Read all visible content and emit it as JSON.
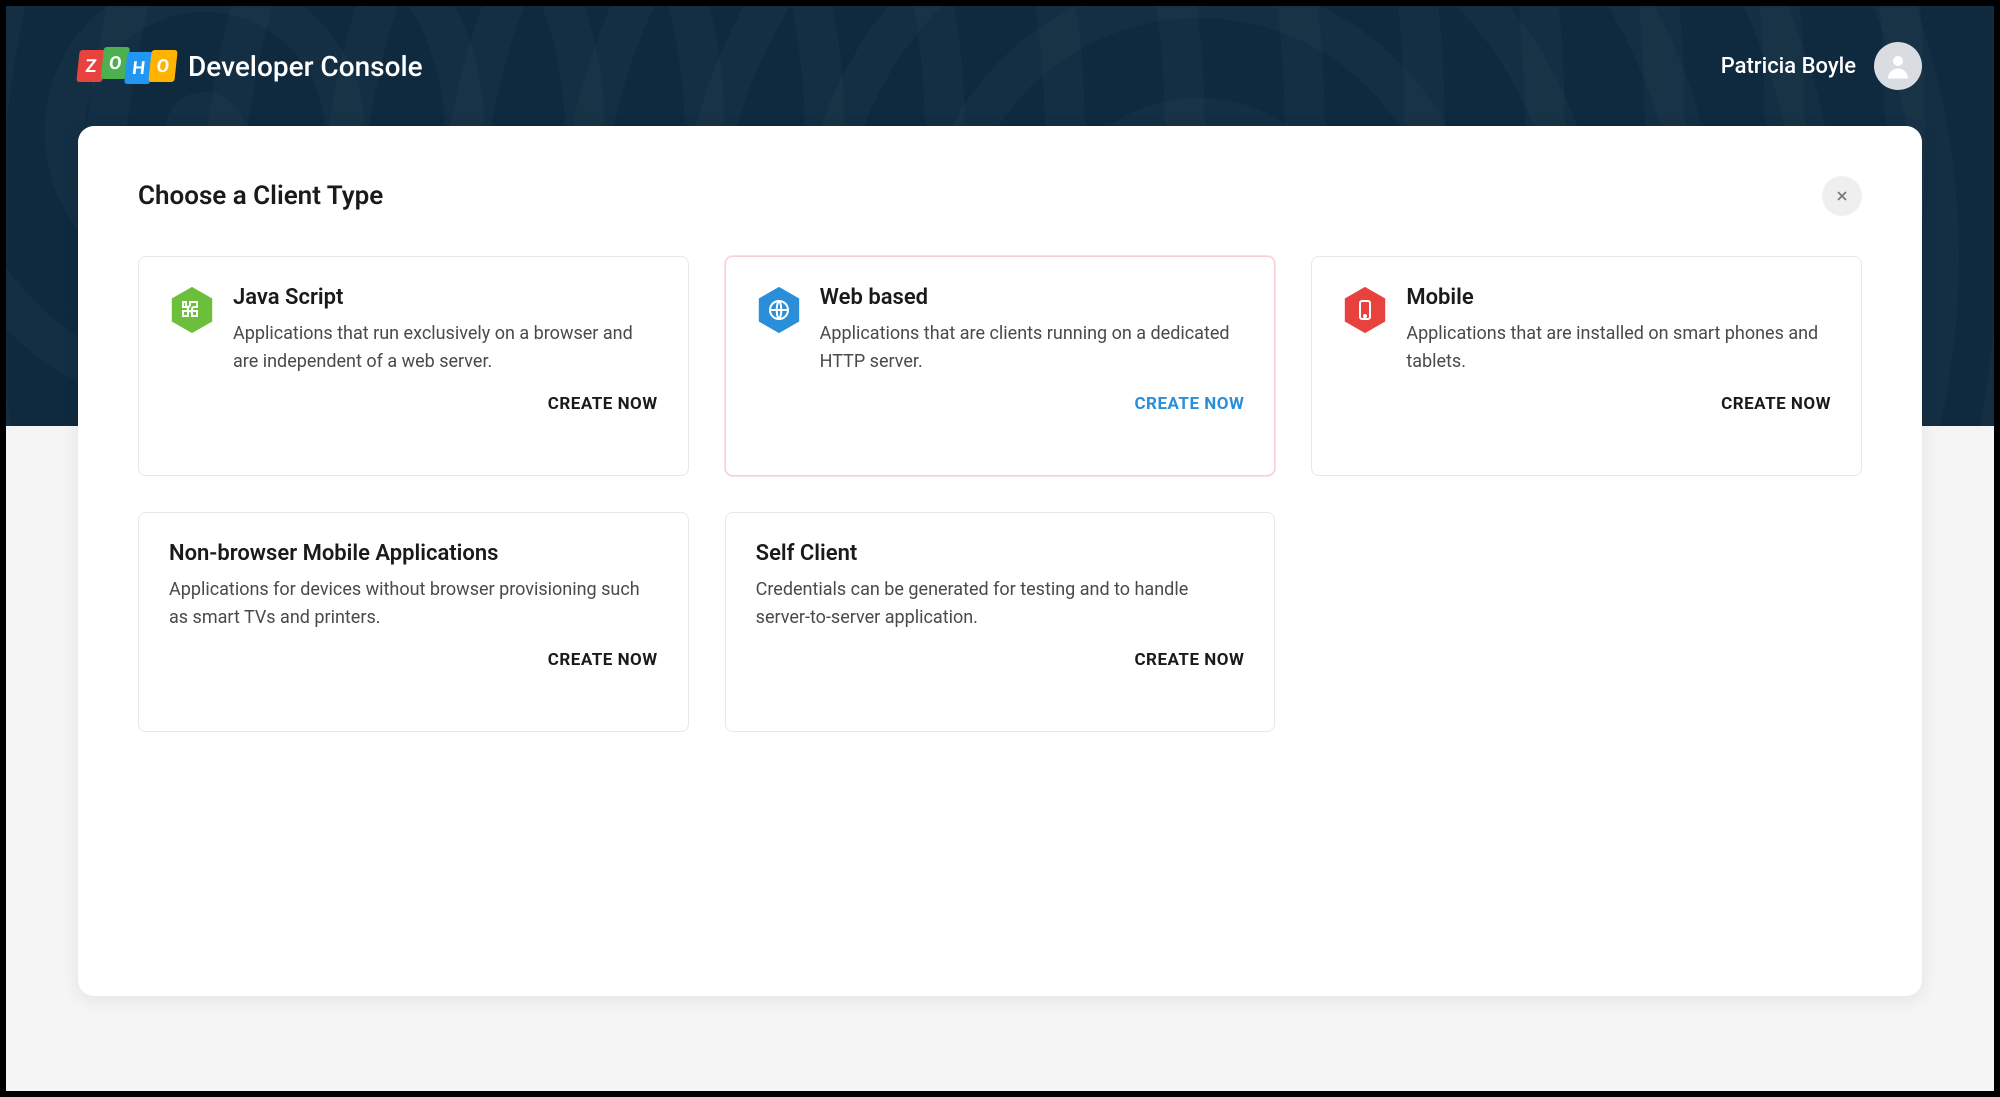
{
  "header": {
    "logo_letters": [
      "Z",
      "O",
      "H",
      "O"
    ],
    "app_title": "Developer Console",
    "user_name": "Patricia Boyle"
  },
  "panel": {
    "title": "Choose a Client Type",
    "create_label": "CREATE NOW"
  },
  "cards": [
    {
      "id": "javascript",
      "title": "Java Script",
      "desc": "Applications that run exclusively on a browser and are independent of a web server.",
      "icon": "puzzle-icon",
      "color": "#6cbf3a",
      "selected": false
    },
    {
      "id": "web-based",
      "title": "Web based",
      "desc": "Applications that are clients running on a dedicated HTTP server.",
      "icon": "globe-icon",
      "color": "#2a8fd8",
      "selected": true
    },
    {
      "id": "mobile",
      "title": "Mobile",
      "desc": "Applications that are installed on smart phones and tablets.",
      "icon": "phone-icon",
      "color": "#e8423f",
      "selected": false
    },
    {
      "id": "non-browser-mobile",
      "title": "Non-browser Mobile Applications",
      "desc": "Applications for devices without browser provisioning such as smart TVs and printers.",
      "icon": "device-icon",
      "color": "#888888",
      "selected": false
    },
    {
      "id": "self-client",
      "title": "Self Client",
      "desc": "Credentials can be generated for testing and to handle server-to-server application.",
      "icon": "person-icon",
      "color": "#888888",
      "selected": false
    }
  ]
}
